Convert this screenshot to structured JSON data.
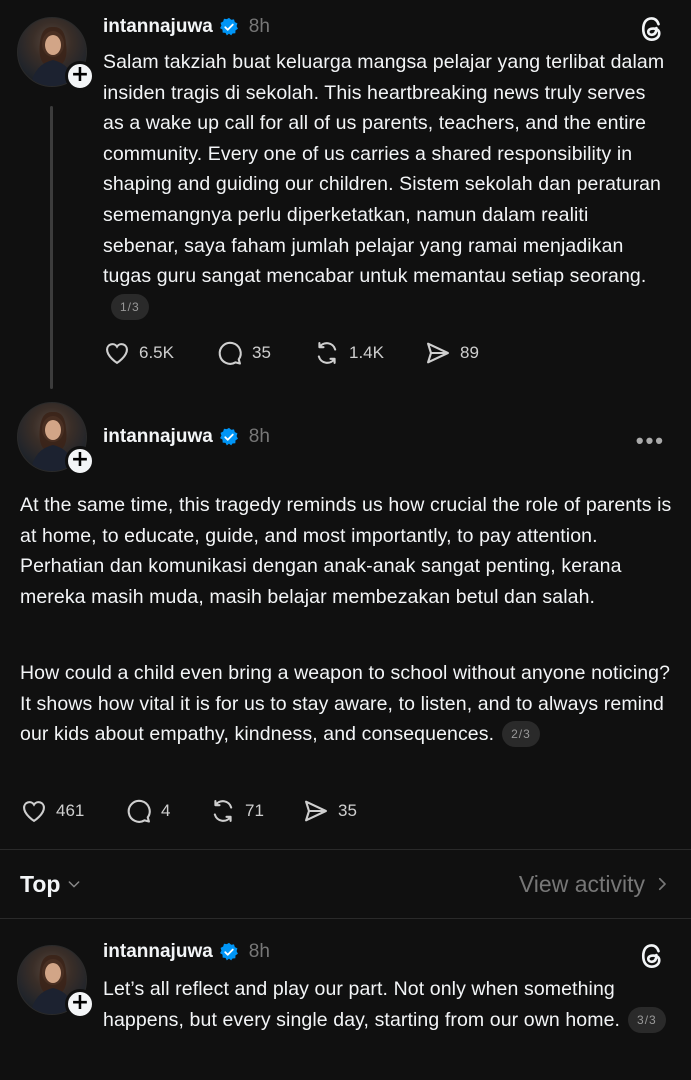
{
  "colors": {
    "background": "#101010",
    "text": "#f3f5f7",
    "muted": "#777777",
    "verified": "#0095f6"
  },
  "posts": [
    {
      "username": "intannajuwa",
      "time": "8h",
      "text": "Salam takziah buat keluarga mangsa pelajar yang terlibat dalam insiden tragis di sekolah. This heartbreaking news truly serves as a wake up call for all of us parents, teachers, and the entire community. Every one of us carries a shared responsibility in shaping and guiding our children. Sistem sekolah dan peraturan sememangnya perlu diperketatkan, namun dalam realiti sebenar, saya faham jumlah pelajar yang ramai menjadikan tugas guru sangat mencabar untuk memantau setiap seorang.",
      "counter": "1/3",
      "likes": "6.5K",
      "replies": "35",
      "reposts": "1.4K",
      "shares": "89"
    },
    {
      "username": "intannajuwa",
      "time": "8h",
      "paragraph1": "At the same time, this tragedy reminds us how crucial the role of parents is at home, to educate, guide, and most importantly, to pay attention. Perhatian dan komunikasi dengan anak-anak sangat penting, kerana mereka masih muda, masih belajar membezakan betul dan salah.",
      "paragraph2": "How could a child even bring a weapon to school without anyone noticing? It shows how vital it is for us to stay aware, to listen, and to always remind our kids about empathy, kindness, and consequences.",
      "counter": "2/3",
      "likes": "461",
      "replies": "4",
      "reposts": "71",
      "shares": "35"
    },
    {
      "username": "intannajuwa",
      "time": "8h",
      "text": "Let’s all reflect and play our part. Not only when something happens, but every single day, starting from our own home.",
      "counter": "3/3"
    }
  ],
  "sort": {
    "label": "Top",
    "activity_label": "View activity"
  }
}
